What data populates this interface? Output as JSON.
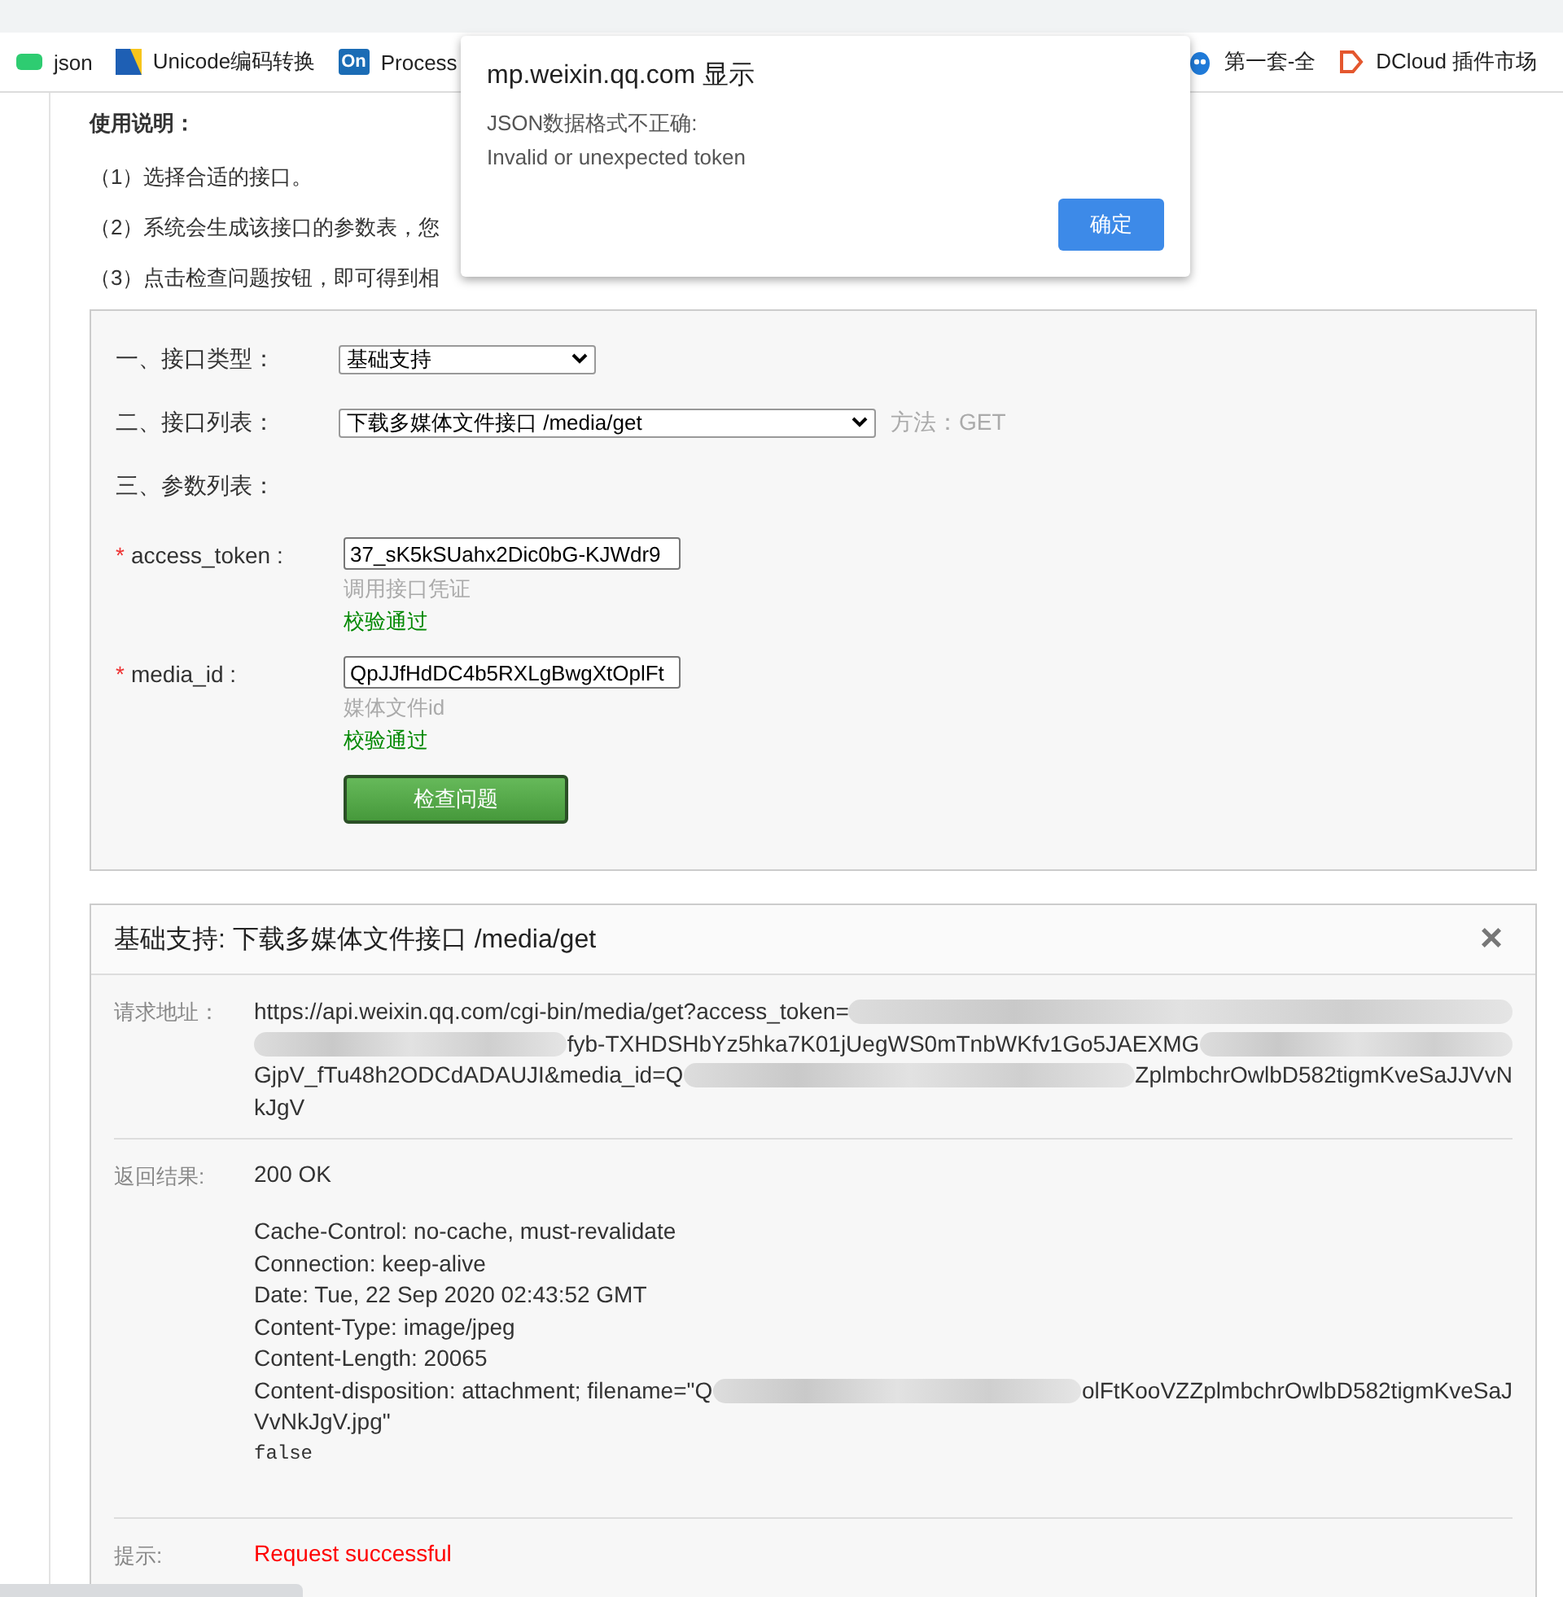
{
  "bookmarks": [
    {
      "label": "json",
      "kind": "json"
    },
    {
      "label": "Unicode编码转换",
      "kind": "unicode"
    },
    {
      "label": "Process",
      "kind": "badge",
      "badge": "On"
    },
    {
      "label": "第一套-全",
      "kind": "mascot"
    },
    {
      "label": "DCloud 插件市场",
      "kind": "dcloud"
    }
  ],
  "dialog": {
    "title": "mp.weixin.qq.com 显示",
    "message": [
      "JSON数据格式不正确:",
      "Invalid or unexpected token"
    ],
    "button": "确定"
  },
  "instructions": {
    "heading": "使用说明：",
    "lines": [
      "（1）选择合适的接口。",
      "（2）系统会生成该接口的参数表，您",
      "（3）点击检查问题按钮，即可得到相"
    ]
  },
  "form": {
    "fields": [
      {
        "kind": "select",
        "label": "一、接口类型：",
        "value": "基础支持"
      },
      {
        "kind": "select",
        "label": "二、接口列表：",
        "value": "下载多媒体文件接口 /media/get",
        "note": "方法：GET"
      },
      {
        "kind": "heading",
        "label": "三、参数列表："
      }
    ],
    "params": [
      {
        "name": "access_token :",
        "required": true,
        "required_mark": "*",
        "value": "37_sK5kSUahx2Dic0bG-KJWdr9",
        "hint": "调用接口凭证",
        "status": "校验通过"
      },
      {
        "name": "media_id :",
        "required": true,
        "required_mark": "*",
        "value": "QpJJfHdDC4b5RXLgBwgXtOplFt",
        "hint": "媒体文件id",
        "status": "校验通过"
      }
    ],
    "submit": "检查问题"
  },
  "result": {
    "title": "基础支持: 下载多媒体文件接口 /media/get",
    "close": "×",
    "rows": [
      {
        "kind": "url",
        "label": "请求地址：",
        "lines": [
          [
            {
              "kind": "text",
              "text": "https://api.weixin.qq.com/cgi-bin/media/get?access_token="
            },
            {
              "kind": "redacted"
            }
          ],
          [
            {
              "kind": "redacted"
            },
            {
              "kind": "text",
              "text": "fyb-TXHDSHbYz5hka7K01jUegWS0mTnbWKfv1Go5JAEXMG"
            },
            {
              "kind": "redacted"
            }
          ],
          [
            {
              "kind": "text",
              "text": "GjpV_fTu48h2ODCdADAUJI&media_id=Q"
            },
            {
              "kind": "redacted"
            },
            {
              "kind": "text",
              "text": "ZplmbchrOwlbD582tigmKveSaJJVvN"
            }
          ],
          [
            {
              "kind": "text",
              "text": "kJgV"
            }
          ]
        ]
      },
      {
        "kind": "response",
        "label": "返回结果:",
        "status": "200 OK",
        "lines": [
          [
            {
              "kind": "text",
              "text": "Cache-Control: no-cache, must-revalidate"
            }
          ],
          [
            {
              "kind": "text",
              "text": "Connection: keep-alive"
            }
          ],
          [
            {
              "kind": "text",
              "text": "Date: Tue, 22 Sep 2020 02:43:52 GMT"
            }
          ],
          [
            {
              "kind": "text",
              "text": "Content-Type: image/jpeg"
            }
          ],
          [
            {
              "kind": "text",
              "text": "Content-Length: 20065"
            }
          ],
          [
            {
              "kind": "text",
              "text": "Content-disposition: attachment; filename=\"Q"
            },
            {
              "kind": "redacted"
            },
            {
              "kind": "text",
              "text": "olFtKooVZZplmbchrOwlbD582tigmKveSaJ"
            }
          ],
          [
            {
              "kind": "text",
              "text": "VvNkJgV.jpg\""
            }
          ]
        ],
        "body": "false"
      },
      {
        "kind": "message",
        "label": "提示:",
        "text": "Request successful"
      }
    ]
  }
}
